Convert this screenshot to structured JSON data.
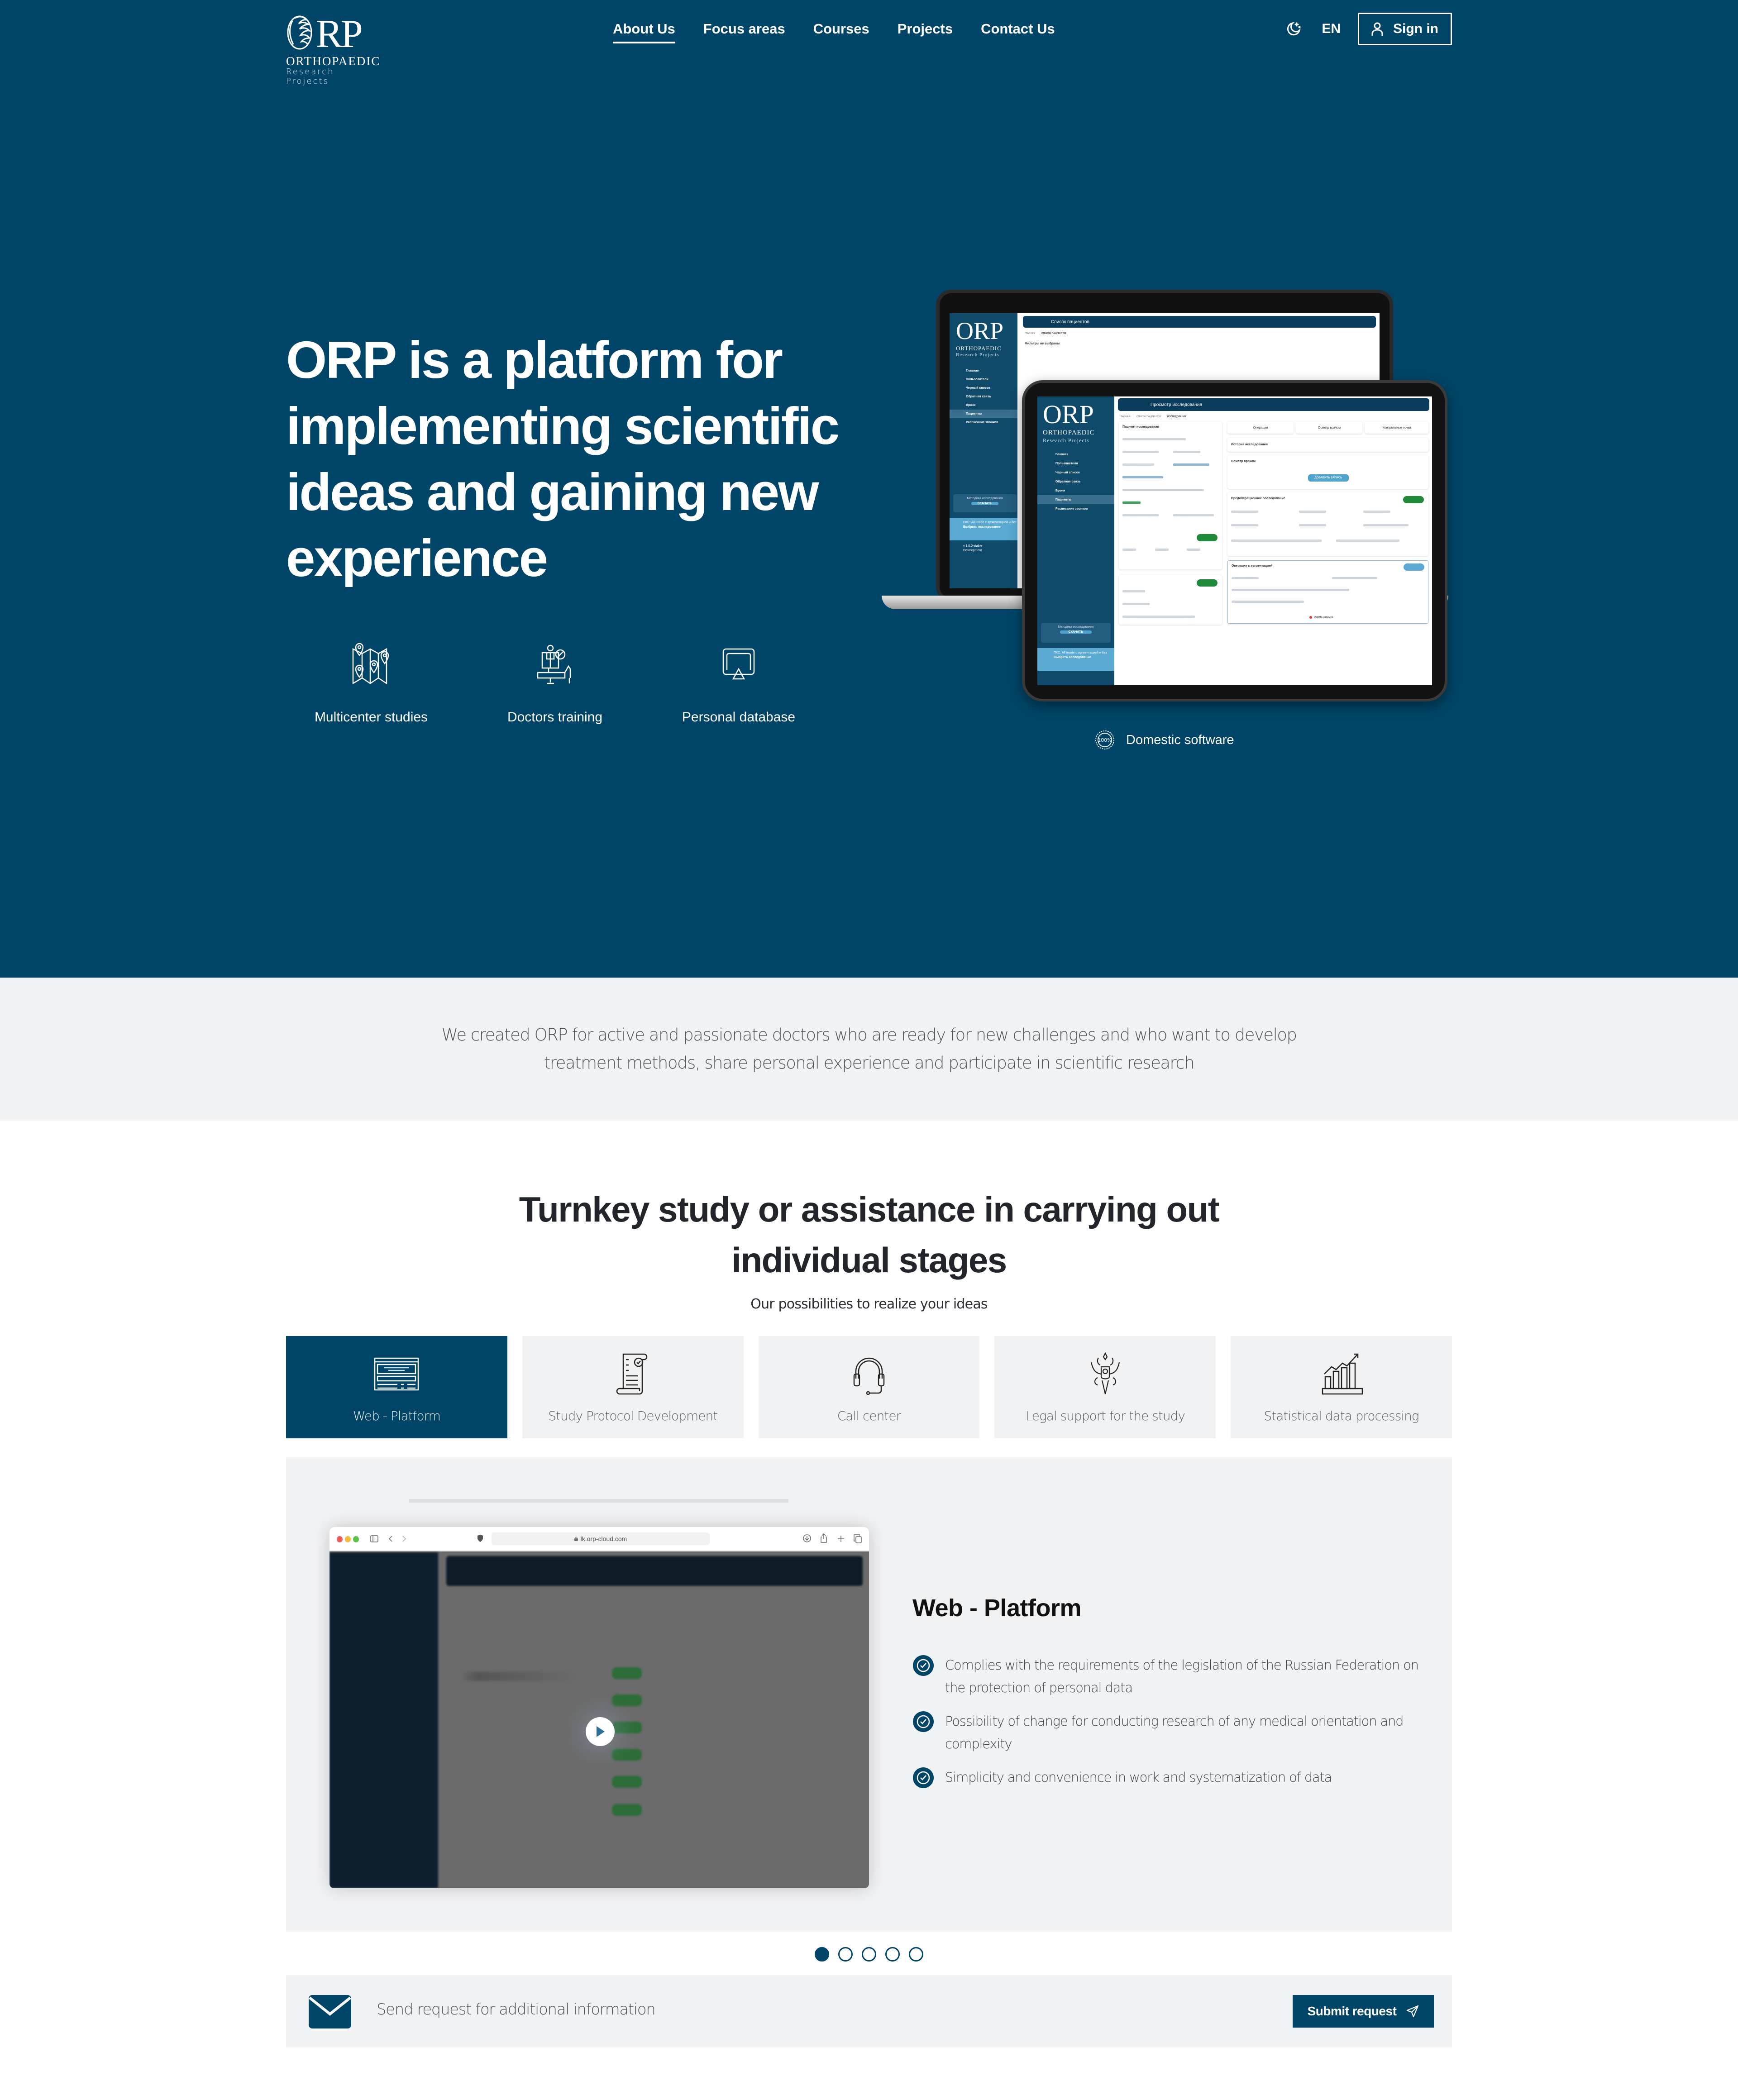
{
  "header": {
    "logo": {
      "mark": "ORP",
      "line1": "ORTHOPAEDIC",
      "line2": "Research Projects"
    },
    "nav": [
      {
        "label": "About Us",
        "active": true
      },
      {
        "label": "Focus areas",
        "active": false
      },
      {
        "label": "Courses",
        "active": false
      },
      {
        "label": "Projects",
        "active": false
      },
      {
        "label": "Contact Us",
        "active": false
      }
    ],
    "theme_icon": "moon-stars-icon",
    "language": "EN",
    "signin_label": "Sign in",
    "signin_icon": "user-icon"
  },
  "hero": {
    "title": "ORP is a platform for implementing scientific ideas and gaining new experience",
    "features": [
      {
        "label": "Multicenter studies",
        "icon": "map-pins-icon"
      },
      {
        "label": "Doctors training",
        "icon": "surgery-training-icon"
      },
      {
        "label": "Personal database",
        "icon": "screen-cast-icon"
      }
    ],
    "devices": {
      "laptop": {
        "page_title": "Список пациентов",
        "breadcrumb": [
          "ГЛАВНАЯ",
          "СПИСОК ПАЦИЕНТОВ"
        ],
        "filter_text": "Фильтры не выбраны",
        "sidebar": [
          "Главная",
          "Пользователи",
          "Черный список",
          "Обратная связь",
          "Врачи",
          "Пациенты",
          "Расписание звонков"
        ],
        "selected": "Пациенты",
        "methodology": "Методика исследования",
        "download": "СКАЧАТЬ",
        "study_card": "ПКС: All Inside с аугментацией и без",
        "study_select": "Выбрать исследование",
        "version": "v 1.0.0-stable",
        "env": "Development"
      },
      "tablet": {
        "page_title": "Просмотр исследования",
        "breadcrumb": [
          "ГЛАВНАЯ",
          "СПИСОК ПАЦИЕНТОВ",
          "ИССЛЕДОВАНИЕ"
        ],
        "tabs": [
          "Операция",
          "Осмотр врачом",
          "Контрольные точки"
        ],
        "patient_card_title": "Пациент исследования",
        "history_title": "История исследования",
        "exam_title": "Осмотр врачом",
        "add_record": "ДОБАВИТЬ ЗАПИСЬ",
        "preop_title": "Предоперационное обследование",
        "operation_title": "Операция с аугментацией",
        "form_closed": "Форма закрыта"
      }
    },
    "domestic": {
      "label": "Domestic software",
      "icon": "badge-100-icon"
    }
  },
  "intro": {
    "text": "We created ORP for active and passionate doctors who are ready for new challenges and who want to develop treatment methods, share personal experience and participate in scientific research"
  },
  "services": {
    "title": "Turnkey study or assistance in carrying out individual stages",
    "subtitle": "Our possibilities to realize your ideas",
    "tabs": [
      {
        "label": "Web - Platform",
        "icon": "web-platform-icon",
        "active": true
      },
      {
        "label": "Study Protocol Development",
        "icon": "protocol-scroll-icon",
        "active": false
      },
      {
        "label": "Call center",
        "icon": "headset-icon",
        "active": false
      },
      {
        "label": "Legal support for the study",
        "icon": "coat-of-arms-icon",
        "active": false
      },
      {
        "label": "Statistical data processing",
        "icon": "bar-chart-growth-icon",
        "active": false
      }
    ],
    "panel": {
      "title": "Web - Platform",
      "video_url": "lk.orp-cloud.com",
      "bullets": [
        "Complies with the requirements of the legislation of the Russian Federation on the protection of personal data",
        "Possibility of change for conducting research of any medical orientation and complexity",
        "Simplicity and convenience in work and systematization of data"
      ]
    },
    "pager": {
      "count": 5,
      "active_index": 0
    },
    "request": {
      "label": "Send request for additional information",
      "button": "Submit request",
      "icon": "mail-icon",
      "button_icon": "send-icon"
    }
  },
  "colors": {
    "brand": "#004567",
    "light_bg": "#f1f2f4",
    "text_dark": "#22252b",
    "success_green": "#1f8a3c"
  }
}
